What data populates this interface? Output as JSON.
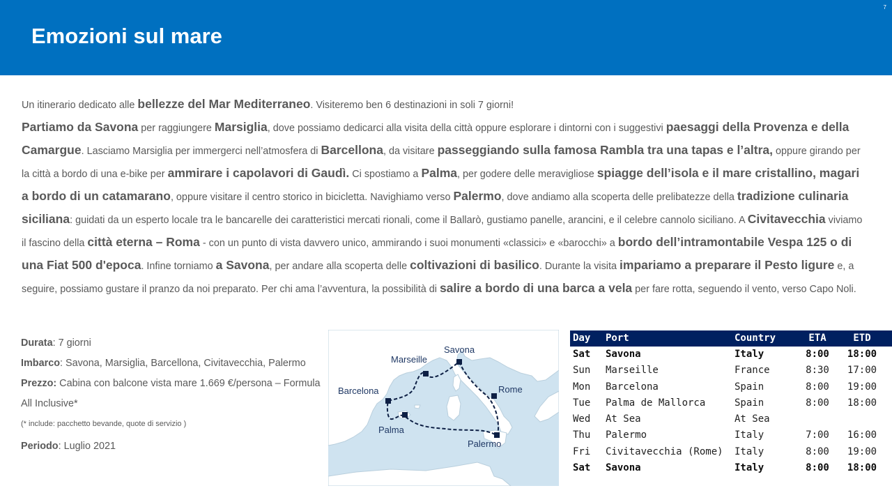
{
  "header": {
    "title": "Emozioni sul mare",
    "page_number": "7"
  },
  "body": {
    "segments": [
      {
        "t": "Un itinerario dedicato alle ",
        "b": false
      },
      {
        "t": "bellezze del Mar Mediterraneo",
        "b": true
      },
      {
        "t": ". Visiteremo ben 6 destinazioni in soli 7 giorni!",
        "b": false
      },
      {
        "t": "Partiamo da Savona",
        "b": true,
        "newline": true
      },
      {
        "t": " per raggiungere ",
        "b": false
      },
      {
        "t": "Marsiglia",
        "b": true
      },
      {
        "t": ", dove possiamo dedicarci alla visita della città oppure esplorare i dintorni con i suggestivi ",
        "b": false
      },
      {
        "t": "paesaggi della Provenza e della Camargue",
        "b": true
      },
      {
        "t": ". Lasciamo Marsiglia per immergerci nell’atmosfera di ",
        "b": false
      },
      {
        "t": "Barcellona",
        "b": true
      },
      {
        "t": ", da visitare ",
        "b": false
      },
      {
        "t": "passeggiando sulla famosa Rambla tra una tapas e l’altra,",
        "b": true
      },
      {
        "t": " oppure girando per la città a bordo di una e-bike per ",
        "b": false
      },
      {
        "t": "ammirare i capolavori di Gaudì.",
        "b": true
      },
      {
        "t": " Ci spostiamo a ",
        "b": false
      },
      {
        "t": "Palma",
        "b": true
      },
      {
        "t": ", per godere delle meravigliose ",
        "b": false
      },
      {
        "t": "spiagge dell’isola e il mare cristallino, magari a bordo di un catamarano",
        "b": true
      },
      {
        "t": ", oppure visitare il centro storico in bicicletta. Navighiamo verso ",
        "b": false
      },
      {
        "t": "Palermo",
        "b": true
      },
      {
        "t": ", dove andiamo alla scoperta delle prelibatezze della ",
        "b": false
      },
      {
        "t": "tradizione culinaria siciliana",
        "b": true
      },
      {
        "t": ": guidati da un esperto locale tra le bancarelle dei caratteristici mercati rionali, come il Ballarò, gustiamo panelle, arancini, e il celebre cannolo siciliano. A ",
        "b": false
      },
      {
        "t": "Civitavecchia",
        "b": true
      },
      {
        "t": " viviamo il fascino della ",
        "b": false
      },
      {
        "t": "città eterna – Roma",
        "b": true
      },
      {
        "t": " - con un punto di vista davvero unico, ammirando i suoi monumenti «classici» e «barocchi» a ",
        "b": false
      },
      {
        "t": "bordo dell’intramontabile Vespa 125 o di una Fiat 500 d'epoca",
        "b": true
      },
      {
        "t": ". Infine torniamo ",
        "b": false
      },
      {
        "t": "a Savona",
        "b": true
      },
      {
        "t": ", per andare alla scoperta delle ",
        "b": false
      },
      {
        "t": "coltivazioni di basilico",
        "b": true
      },
      {
        "t": ". Durante la visita ",
        "b": false
      },
      {
        "t": "impariamo a preparare il Pesto ligure",
        "b": true
      },
      {
        "t": " e, a seguire, possiamo gustare il pranzo da noi preparato. Per chi ama l’avventura, la possibilità di ",
        "b": false
      },
      {
        "t": "salire a bordo di una barca a vela",
        "b": true
      },
      {
        "t": " per fare rotta, seguendo il vento, verso Capo Noli.",
        "b": false
      }
    ]
  },
  "info": {
    "duration_label": "Durata",
    "duration_value": ": 7 giorni",
    "boarding_label": "Imbarco",
    "boarding_value": ": Savona, Marsiglia, Barcellona, Civitavecchia, Palermo",
    "price_label": "Prezzo:",
    "price_value": " Cabina con balcone vista mare 1.669 €/persona – Formula All Inclusive*",
    "note": "(* include: pacchetto bevande, quote di servizio )",
    "period_label": "Periodo",
    "period_value": ": Luglio 2021"
  },
  "map": {
    "labels": {
      "savona": "Savona",
      "marseille": "Marseille",
      "barcelona": "Barcelona",
      "rome": "Rome",
      "palma": "Palma",
      "palermo": "Palermo"
    },
    "colors": {
      "sea": "#cfe3f0",
      "land": "#ffffff",
      "route": "#0d1f44"
    }
  },
  "itinerary": {
    "headers": {
      "day": "Day",
      "port": "Port",
      "country": "Country",
      "eta": "ETA",
      "etd": "ETD"
    },
    "rows": [
      {
        "day": "Sat",
        "port": "Savona",
        "country": "Italy",
        "eta": "8:00",
        "etd": "18:00",
        "bold": true
      },
      {
        "day": "Sun",
        "port": "Marseille",
        "country": "France",
        "eta": "8:30",
        "etd": "17:00",
        "bold": false
      },
      {
        "day": "Mon",
        "port": "Barcelona",
        "country": "Spain",
        "eta": "8:00",
        "etd": "19:00",
        "bold": false
      },
      {
        "day": "Tue",
        "port": "Palma de Mallorca",
        "country": "Spain",
        "eta": "8:00",
        "etd": "18:00",
        "bold": false
      },
      {
        "day": "Wed",
        "port": "At Sea",
        "country": "At Sea",
        "eta": "",
        "etd": "",
        "bold": false
      },
      {
        "day": "Thu",
        "port": "Palermo",
        "country": "Italy",
        "eta": "7:00",
        "etd": "16:00",
        "bold": false
      },
      {
        "day": "Fri",
        "port": "Civitavecchia (Rome)",
        "country": "Italy",
        "eta": "8:00",
        "etd": "19:00",
        "bold": false
      },
      {
        "day": "Sat",
        "port": "Savona",
        "country": "Italy",
        "eta": "8:00",
        "etd": "18:00",
        "bold": true
      }
    ]
  }
}
